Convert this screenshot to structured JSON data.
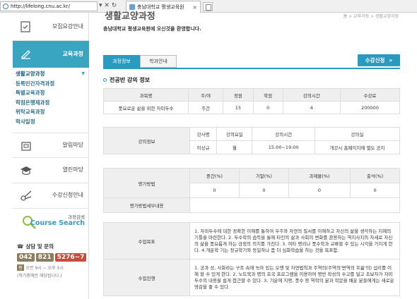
{
  "browser": {
    "url": "http://lifelong.cnu.ac.kr/",
    "tab_title": "충남대학교 평생교육원",
    "close": "×",
    "nav_glyphs": "▾ ✕ ↻"
  },
  "sidebar": {
    "menus": [
      {
        "label": "모집요강안내",
        "icon": "checklist-icon"
      },
      {
        "label": "교육과정",
        "icon": "pencil-icon",
        "active": true
      },
      {
        "label": "알림마당",
        "icon": "notice-icon"
      },
      {
        "label": "열린마당",
        "icon": "graduation-cap-icon"
      },
      {
        "label": "수강신청안내",
        "icon": "scissors-icon"
      }
    ],
    "sub_items": [
      "생활교양과정",
      "등록민간자격과정",
      "특별교육과정",
      "학점은행제과정",
      "위탁교육과정",
      "학사일정"
    ],
    "course_search_small": "과정검색",
    "course_search_title": "Course Search",
    "contact_title": "상담 및 문의",
    "phone_parts": [
      "042",
      "821",
      "5276~7"
    ],
    "hours_badge": "평",
    "hours_text": "오전 9시 ~ 오후 5시",
    "hours_note": "(학기중에만 해당됩니다.)"
  },
  "main": {
    "title_peek": "생활교양과정",
    "breadcrumb": "홈 > 교육과정 > 생활교양과정",
    "welcome": "충남대학교 평생교육원에 오신것을 환영합니다.",
    "tabs": [
      "과정정보",
      "학과안내"
    ],
    "apply_button": "수강신청",
    "apply_arrow": "»",
    "section_title": "전공반 강의 정보",
    "course_table": {
      "headers": [
        "과목명",
        "주/야",
        "정원",
        "학점",
        "강의시간",
        "수강료"
      ],
      "row": [
        "풍요로운 삶을 위한 자미두수",
        "주간",
        "15",
        "0",
        "4",
        "200000"
      ]
    },
    "lecture_info": {
      "label": "강의정보",
      "headers": [
        "강사명",
        "강의요일",
        "강의시간",
        "강의실"
      ],
      "row": [
        "이상규",
        "월",
        "15:00~19:00",
        "개강시 홈페이지에 별도 공지"
      ]
    },
    "evaluation": {
      "label": "평가방법",
      "headers": [
        "중간(%)",
        "기말(%)",
        "과제물(%)",
        "출석(%)"
      ],
      "row": [
        "0",
        "0",
        "0",
        "0"
      ],
      "detail_label": "평가방법세부내용",
      "detail_value": ""
    },
    "goals": {
      "label": "수업목표",
      "text": "1. 자미두수에 대한 정확한 이해를 통하여 우주와 자연의 질서를 이해하고 자신의 삶을 생각하는 지혜의 기틀을 마련한다. 2. 두수학의 습득을 통해 타인의 삶과 사회의 변화를 관용하는 역지사지의 자세로 자신의 삶을 풍요롭게 하는 긍정의 의지를 가진다. 3. 여타 명리나 풍수학과 교류할 수 있는 시각을 가지게 한다. 4.개운학 기는 정규학기와 동일하나 좀 더 심화학습을 하는 것을 목표함."
    },
    "progress": {
      "label": "수업진행",
      "text": "1. 궁과 성, 사화라는 구조 속에 녹아 있는 오행 및 자연법칙과 주역의(주역의'변역의 흐름'의) 섭리를 이해 할 수 있게 한다. 2. 노트북과 명의 효국 프로그램을 이용하여 명반 작성의 수고를 덜고 초보자가 자미두수의 내용을 쉽게 접근할 수 있다. 3. 기운에 지평, 풍수 등 역학의 분과 학문을 배운 분들에게는 새로운 영감을 줄 수 있다."
    }
  }
}
